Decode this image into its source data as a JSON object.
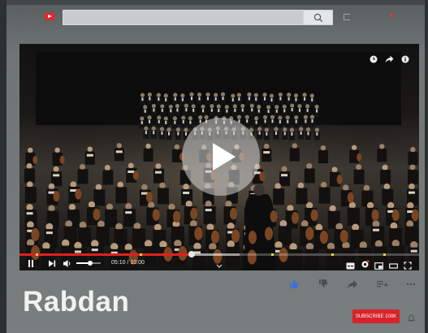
{
  "search": {
    "value": "",
    "placeholder": ""
  },
  "player": {
    "time": {
      "current": "05:10",
      "separator": " / ",
      "total": "10:00"
    },
    "progress": 0.43,
    "buffered": 0.55,
    "volume": 0.55,
    "ad_markers": [
      0.04,
      0.3,
      0.63,
      0.78,
      0.91
    ],
    "icons": {
      "top": [
        "clock-icon",
        "share-icon",
        "info-icon"
      ],
      "left": [
        "pause-icon",
        "next-icon",
        "volume-icon"
      ],
      "right": [
        "subtitles-icon",
        "settings-icon",
        "miniplayer-icon",
        "theater-icon",
        "fullscreen-icon"
      ]
    }
  },
  "video": {
    "title": "Rabdan"
  },
  "actions": [
    "like-icon",
    "dislike-icon",
    "share-icon",
    "save-to-playlist-icon",
    "more-icon"
  ],
  "channel": {
    "subscribe_label": "SUBSCRIBE 100K"
  },
  "colors": {
    "accent": "#e02020",
    "subscribe": "#d8232a",
    "like_active": "#3b6fd8"
  }
}
